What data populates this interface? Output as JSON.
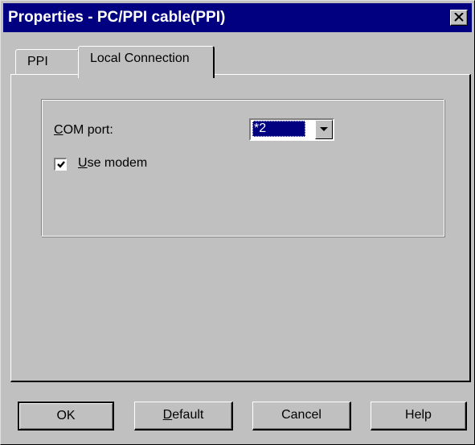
{
  "window": {
    "title": "Properties - PC/PPI cable(PPI)"
  },
  "tabs": [
    {
      "label": "PPI",
      "selected": false
    },
    {
      "label": "Local Connection",
      "selected": true
    }
  ],
  "local_connection": {
    "com_port_label_accel": "C",
    "com_port_label_rest": "OM port:",
    "com_port_value": "*2",
    "use_modem_accel": "U",
    "use_modem_rest": "se modem",
    "use_modem_checked": true
  },
  "buttons": {
    "ok": "OK",
    "default_accel": "D",
    "default_rest": "efault",
    "cancel": "Cancel",
    "help": "Help"
  },
  "icons": {
    "close": "close-icon",
    "dropdown": "chevron-down-icon",
    "check": "checkmark-icon"
  },
  "colors": {
    "titlebar": "#000080",
    "face": "#c0c0c0",
    "selection": "#000080"
  }
}
